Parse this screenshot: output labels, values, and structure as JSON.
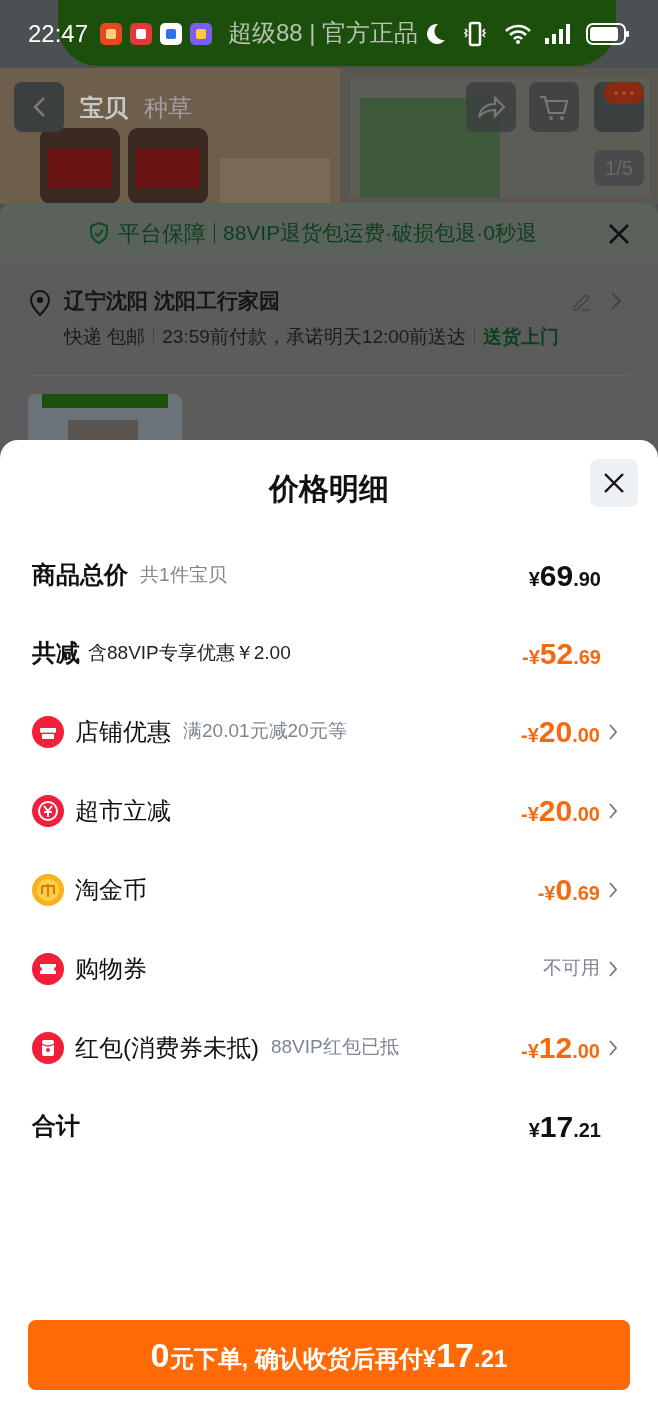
{
  "status_bar": {
    "time": "22:47"
  },
  "banner": {
    "text": "超级88 | 官方正品"
  },
  "nav": {
    "tabs": [
      {
        "label": "宝贝",
        "selected": true
      },
      {
        "label": "种草",
        "selected": false
      }
    ],
    "image_counter": "1/5"
  },
  "guarantee": {
    "title": "平台保障",
    "text": "88VIP退货包运费·破损包退·0秒退"
  },
  "address": {
    "location": "辽宁沈阳 沈阳工行家园",
    "delivery": "快递 包邮",
    "promise": "23:59前付款，承诺明天12:00前送达",
    "service": "送货上门"
  },
  "sheet": {
    "title": "价格明细",
    "subtotal": {
      "label": "商品总价",
      "note": "共1件宝贝",
      "amount": {
        "sign": "¥",
        "int": "69",
        "dec": ".90"
      }
    },
    "reduction": {
      "label": "共减",
      "note": "含88VIP专享优惠￥2.00",
      "amount": {
        "sign": "-¥",
        "int": "52",
        "dec": ".69"
      }
    },
    "discounts": [
      {
        "kind": "shop",
        "label": "店铺优惠",
        "note": "满20.01元减20元等",
        "amount": {
          "sign": "-¥",
          "int": "20",
          "dec": ".00"
        }
      },
      {
        "kind": "instant",
        "label": "超市立减",
        "amount": {
          "sign": "-¥",
          "int": "20",
          "dec": ".00"
        }
      },
      {
        "kind": "coin",
        "label": "淘金币",
        "amount": {
          "sign": "-¥",
          "int": "0",
          "dec": ".69"
        }
      },
      {
        "kind": "coupon",
        "label": "购物券",
        "status": "不可用"
      },
      {
        "kind": "redpacket",
        "label": "红包(消费券未抵)",
        "note": "88VIP红包已抵",
        "amount": {
          "sign": "-¥",
          "int": "12",
          "dec": ".00"
        }
      }
    ],
    "total": {
      "label": "合计",
      "amount": {
        "sign": "¥",
        "int": "17",
        "dec": ".21"
      }
    },
    "order_button": {
      "deposit": "0",
      "label": "元下单, 确认收货后再付",
      "amount": {
        "sign": "¥",
        "int": "17",
        "dec": ".21"
      }
    }
  }
}
